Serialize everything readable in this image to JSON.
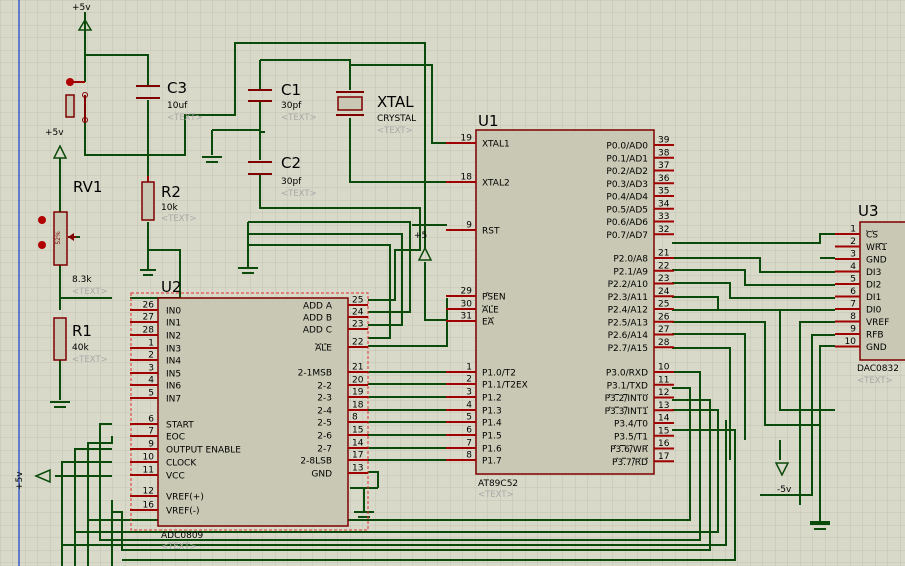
{
  "text_tag": "<TEXT>",
  "power": {
    "top": "+5v",
    "left_a": "+5v",
    "rst": "+5",
    "left_side": "+5v",
    "neg": "-5v"
  },
  "C3": {
    "ref": "C3",
    "value": "10uf"
  },
  "C1": {
    "ref": "C1",
    "value": "30pf"
  },
  "C2": {
    "ref": "C2",
    "value": "30pf"
  },
  "XTAL": {
    "ref": "XTAL",
    "value": "CRYSTAL"
  },
  "R2": {
    "ref": "R2",
    "value": "10k"
  },
  "RV1": {
    "ref": "RV1",
    "value": "8.3k",
    "body_text": "52%"
  },
  "R1": {
    "ref": "R1",
    "value": "40k"
  },
  "U2": {
    "ref": "U2",
    "part": "ADC0809",
    "left_pins": [
      {
        "num": "26",
        "name": "IN0"
      },
      {
        "num": "27",
        "name": "IN1"
      },
      {
        "num": "28",
        "name": "IN2"
      },
      {
        "num": "1",
        "name": "IN3"
      },
      {
        "num": "2",
        "name": "IN4"
      },
      {
        "num": "3",
        "name": "IN5"
      },
      {
        "num": "4",
        "name": "IN6"
      },
      {
        "num": "5",
        "name": "IN7"
      },
      {
        "num": "6",
        "name": "START"
      },
      {
        "num": "7",
        "name": "EOC"
      },
      {
        "num": "9",
        "name": "OUTPUT ENABLE"
      },
      {
        "num": "10",
        "name": "CLOCK"
      },
      {
        "num": "11",
        "name": "VCC"
      },
      {
        "num": "12",
        "name": "VREF(+)"
      },
      {
        "num": "16",
        "name": "VREF(-)"
      }
    ],
    "right_pins": [
      {
        "num": "25",
        "name": "ADD A"
      },
      {
        "num": "24",
        "name": "ADD B"
      },
      {
        "num": "23",
        "name": "ADD C"
      },
      {
        "num": "22",
        "name": "ALE"
      },
      {
        "num": "21",
        "name": "2-1MSB"
      },
      {
        "num": "20",
        "name": "2-2"
      },
      {
        "num": "19",
        "name": "2-3"
      },
      {
        "num": "18",
        "name": "2-4"
      },
      {
        "num": "8",
        "name": "2-5"
      },
      {
        "num": "15",
        "name": "2-6"
      },
      {
        "num": "14",
        "name": "2-7"
      },
      {
        "num": "17",
        "name": "2-8LSB"
      },
      {
        "num": "13",
        "name": "GND"
      }
    ]
  },
  "U1": {
    "ref": "U1",
    "part": "AT89C52",
    "left_pins": [
      {
        "num": "19",
        "name": "XTAL1"
      },
      {
        "num": "18",
        "name": "XTAL2"
      },
      {
        "num": "9",
        "name": "RST"
      },
      {
        "num": "29",
        "name": "PSEN"
      },
      {
        "num": "30",
        "name": "ALE"
      },
      {
        "num": "31",
        "name": "EA"
      },
      {
        "num": "1",
        "name": "P1.0/T2"
      },
      {
        "num": "2",
        "name": "P1.1/T2EX"
      },
      {
        "num": "3",
        "name": "P1.2"
      },
      {
        "num": "4",
        "name": "P1.3"
      },
      {
        "num": "5",
        "name": "P1.4"
      },
      {
        "num": "6",
        "name": "P1.5"
      },
      {
        "num": "7",
        "name": "P1.6"
      },
      {
        "num": "8",
        "name": "P1.7"
      }
    ],
    "right_pins": [
      {
        "num": "39",
        "name": "P0.0/AD0"
      },
      {
        "num": "38",
        "name": "P0.1/AD1"
      },
      {
        "num": "37",
        "name": "P0.2/AD2"
      },
      {
        "num": "36",
        "name": "P0.3/AD3"
      },
      {
        "num": "35",
        "name": "P0.4/AD4"
      },
      {
        "num": "34",
        "name": "P0.5/AD5"
      },
      {
        "num": "33",
        "name": "P0.6/AD6"
      },
      {
        "num": "32",
        "name": "P0.7/AD7"
      },
      {
        "num": "21",
        "name": "P2.0/A8"
      },
      {
        "num": "22",
        "name": "P2.1/A9"
      },
      {
        "num": "23",
        "name": "P2.2/A10"
      },
      {
        "num": "24",
        "name": "P2.3/A11"
      },
      {
        "num": "25",
        "name": "P2.4/A12"
      },
      {
        "num": "26",
        "name": "P2.5/A13"
      },
      {
        "num": "27",
        "name": "P2.6/A14"
      },
      {
        "num": "28",
        "name": "P2.7/A15"
      },
      {
        "num": "10",
        "name": "P3.0/RXD"
      },
      {
        "num": "11",
        "name": "P3.1/TXD"
      },
      {
        "num": "12",
        "name": "P3.2/INT0"
      },
      {
        "num": "13",
        "name": "P3.3/INT1"
      },
      {
        "num": "14",
        "name": "P3.4/T0"
      },
      {
        "num": "15",
        "name": "P3.5/T1"
      },
      {
        "num": "16",
        "name": "P3.6/WR"
      },
      {
        "num": "17",
        "name": "P3.7/RD"
      }
    ]
  },
  "U3": {
    "ref": "U3",
    "part": "DAC0832",
    "pins": [
      {
        "num": "1",
        "name": "CS"
      },
      {
        "num": "2",
        "name": "WR1"
      },
      {
        "num": "3",
        "name": "GND"
      },
      {
        "num": "4",
        "name": "DI3"
      },
      {
        "num": "5",
        "name": "DI2"
      },
      {
        "num": "6",
        "name": "DI1"
      },
      {
        "num": "7",
        "name": "DI0"
      },
      {
        "num": "8",
        "name": "VREF"
      },
      {
        "num": "9",
        "name": "RFB"
      },
      {
        "num": "10",
        "name": "GND"
      }
    ]
  }
}
